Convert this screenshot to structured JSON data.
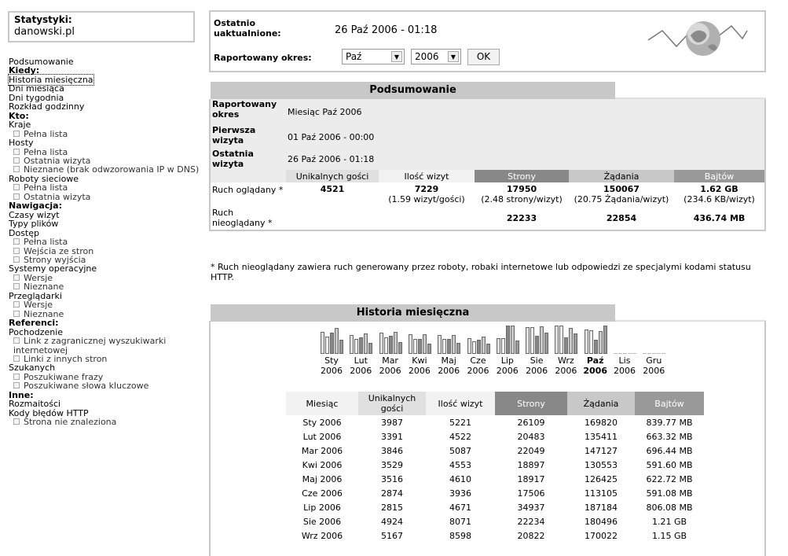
{
  "sidebar": {
    "stats_title": "Statystyki:",
    "site": "danowski.pl",
    "menu": [
      {
        "label": "Podsumowanie",
        "type": "link"
      },
      {
        "label": "Kiedy:",
        "type": "heading"
      },
      {
        "label": "Historia miesięczna",
        "type": "link",
        "selected": true
      },
      {
        "label": "Dni miesiąca",
        "type": "link"
      },
      {
        "label": "Dni tygodnia",
        "type": "link"
      },
      {
        "label": "Rozkład godzinny",
        "type": "link"
      },
      {
        "label": "Kto:",
        "type": "heading"
      },
      {
        "label": "Kraje",
        "type": "link"
      },
      {
        "label": "Pełna lista",
        "type": "sub"
      },
      {
        "label": "Hosty",
        "type": "link"
      },
      {
        "label": "Pełna lista",
        "type": "sub"
      },
      {
        "label": "Ostatnia wizyta",
        "type": "sub"
      },
      {
        "label": "Nieznane (brak odwzorowania IP w DNS)",
        "type": "sub"
      },
      {
        "label": "Roboty sieciowe",
        "type": "link"
      },
      {
        "label": "Pełna lista",
        "type": "sub"
      },
      {
        "label": "Ostatnia wizyta",
        "type": "sub"
      },
      {
        "label": "Nawigacja:",
        "type": "heading"
      },
      {
        "label": "Czasy wizyt",
        "type": "link"
      },
      {
        "label": "Typy plików",
        "type": "link"
      },
      {
        "label": "Dostęp",
        "type": "link"
      },
      {
        "label": "Pełna lista",
        "type": "sub"
      },
      {
        "label": "Wejścia ze stron",
        "type": "sub"
      },
      {
        "label": "Strony wyjścia",
        "type": "sub"
      },
      {
        "label": "Systemy operacyjne",
        "type": "link"
      },
      {
        "label": "Wersje",
        "type": "sub"
      },
      {
        "label": "Nieznane",
        "type": "sub"
      },
      {
        "label": "Przeglądarki",
        "type": "link"
      },
      {
        "label": "Wersje",
        "type": "sub"
      },
      {
        "label": "Nieznane",
        "type": "sub"
      },
      {
        "label": "Referenci:",
        "type": "heading"
      },
      {
        "label": "Pochodzenie",
        "type": "link"
      },
      {
        "label": "Link z zagranicznej wyszukiwarki internetowej",
        "type": "sub"
      },
      {
        "label": "Linki z innych stron",
        "type": "sub"
      },
      {
        "label": "Szukanych",
        "type": "link"
      },
      {
        "label": "Poszukiwane frazy",
        "type": "sub"
      },
      {
        "label": "Poszukiwane słowa kluczowe",
        "type": "sub"
      },
      {
        "label": "Inne:",
        "type": "heading"
      },
      {
        "label": "Rozmaitości",
        "type": "link"
      },
      {
        "label": "Kody błędów HTTP",
        "type": "link"
      },
      {
        "label": "Strona nie znaleziona",
        "type": "sub"
      }
    ]
  },
  "header": {
    "updated_label": "Ostatnio uaktualnione:",
    "updated_value": "26 Paź 2006 - 01:18",
    "period_label": "Raportowany okres:",
    "month_select": "Paź",
    "year_select": "2006",
    "ok": "OK"
  },
  "summary": {
    "title": "Podsumowanie",
    "rows": [
      {
        "label": "Raportowany okres",
        "value": "Miesiąc Paź 2006"
      },
      {
        "label": "Pierwsza wizyta",
        "value": "01 Paź 2006 - 00:00"
      },
      {
        "label": "Ostatnia wizyta",
        "value": "26 Paź 2006 - 01:18"
      }
    ],
    "columns": [
      "Unikalnych gości",
      "Ilość wizyt",
      "Strony",
      "Żądania",
      "Bajtów"
    ],
    "viewed": {
      "label": "Ruch oglądany *",
      "unique": "4521",
      "visits": "7229",
      "visits_sub": "(1.59 wizyt/gości)",
      "pages": "17950",
      "pages_sub": "(2.48 strony/wizyt)",
      "hits": "150067",
      "hits_sub": "(20.75 Żądania/wizyt)",
      "bytes": "1.62 GB",
      "bytes_sub": "(234.6 KB/wizyt)"
    },
    "not_viewed": {
      "label": "Ruch nieoglądany *",
      "pages": "22233",
      "hits": "22854",
      "bytes": "436.74 MB"
    },
    "note": "* Ruch nieoglądany zawiera ruch generowany przez roboty, robaki internetowe lub odpowiedzi ze specjalymi kodami statusu HTTP."
  },
  "history": {
    "title": "Historia miesięczna",
    "months": [
      {
        "m": "Sty",
        "y": "2006"
      },
      {
        "m": "Lut",
        "y": "2006"
      },
      {
        "m": "Mar",
        "y": "2006"
      },
      {
        "m": "Kwi",
        "y": "2006"
      },
      {
        "m": "Maj",
        "y": "2006"
      },
      {
        "m": "Cze",
        "y": "2006"
      },
      {
        "m": "Lip",
        "y": "2006"
      },
      {
        "m": "Sie",
        "y": "2006"
      },
      {
        "m": "Wrz",
        "y": "2006"
      },
      {
        "m": "Paź",
        "y": "2006",
        "bold": true
      },
      {
        "m": "Lis",
        "y": "2006"
      },
      {
        "m": "Gru",
        "y": "2006"
      }
    ],
    "columns": [
      "Miesiąc",
      "Unikalnych gości",
      "Ilość wizyt",
      "Strony",
      "Żądania",
      "Bajtów"
    ],
    "rows": [
      [
        "Sty 2006",
        "3987",
        "5221",
        "26109",
        "169820",
        "839.77 MB"
      ],
      [
        "Lut 2006",
        "3391",
        "4522",
        "20483",
        "135411",
        "663.32 MB"
      ],
      [
        "Mar 2006",
        "3846",
        "5087",
        "22049",
        "147127",
        "696.44 MB"
      ],
      [
        "Kwi 2006",
        "3529",
        "4553",
        "18897",
        "130553",
        "591.60 MB"
      ],
      [
        "Maj 2006",
        "3516",
        "4610",
        "18917",
        "126425",
        "622.72 MB"
      ],
      [
        "Cze 2006",
        "2874",
        "3936",
        "17506",
        "113105",
        "591.08 MB"
      ],
      [
        "Lip 2006",
        "2815",
        "4671",
        "34937",
        "187184",
        "806.08 MB"
      ],
      [
        "Sie 2006",
        "4924",
        "8071",
        "22234",
        "180496",
        "1.21 GB"
      ],
      [
        "Wrz 2006",
        "5167",
        "8598",
        "20822",
        "170022",
        "1.15 GB"
      ]
    ]
  },
  "chart_data": {
    "type": "bar",
    "categories": [
      "Sty 2006",
      "Lut 2006",
      "Mar 2006",
      "Kwi 2006",
      "Maj 2006",
      "Cze 2006",
      "Lip 2006",
      "Sie 2006",
      "Wrz 2006",
      "Paź 2006",
      "Lis 2006",
      "Gru 2006"
    ],
    "series": [
      {
        "name": "Unikalnych gości",
        "values": [
          3987,
          3391,
          3846,
          3529,
          3516,
          2874,
          2815,
          4924,
          5167,
          4521,
          0,
          0
        ]
      },
      {
        "name": "Ilość wizyt",
        "values": [
          5221,
          4522,
          5087,
          4553,
          4610,
          3936,
          4671,
          8071,
          8598,
          7229,
          0,
          0
        ]
      },
      {
        "name": "Strony",
        "values": [
          26109,
          20483,
          22049,
          18897,
          18917,
          17506,
          34937,
          22234,
          20822,
          17950,
          0,
          0
        ]
      },
      {
        "name": "Żądania",
        "values": [
          169820,
          135411,
          147127,
          130553,
          126425,
          113105,
          187184,
          180496,
          170022,
          150067,
          0,
          0
        ]
      },
      {
        "name": "Bajtów",
        "values": [
          839.77,
          663.32,
          696.44,
          591.6,
          622.72,
          591.08,
          806.08,
          1239.04,
          1177.6,
          1658.88,
          0,
          0
        ]
      }
    ],
    "colors": {
      "uni": "#e0e0e0",
      "viz": "#f2f2f2",
      "str": "#888888",
      "zad": "#c8c8c8",
      "baj": "#999999"
    }
  }
}
